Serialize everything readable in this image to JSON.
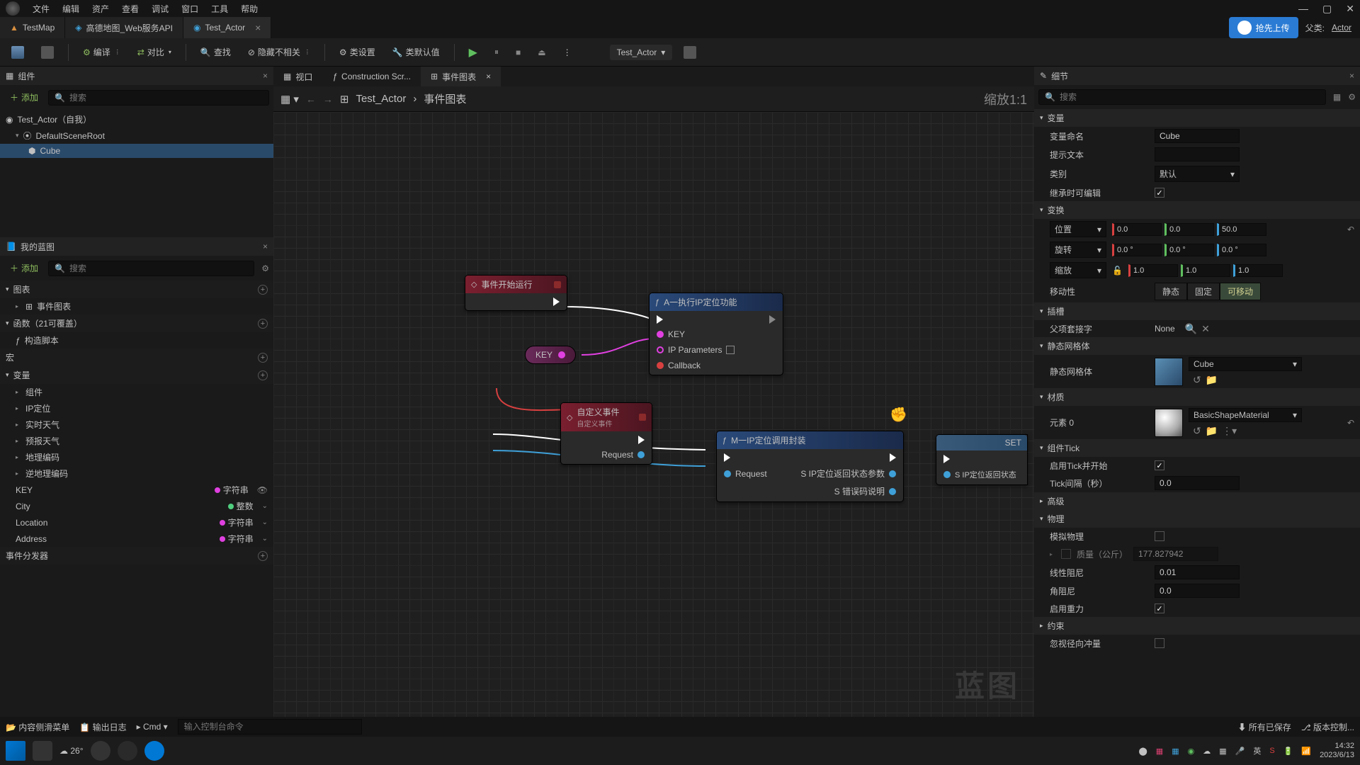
{
  "menubar": {
    "items": [
      "文件",
      "编辑",
      "资产",
      "查看",
      "调试",
      "窗口",
      "工具",
      "帮助"
    ]
  },
  "tabs": {
    "items": [
      {
        "label": "TestMap"
      },
      {
        "label": "高德地图_Web服务API"
      },
      {
        "label": "Test_Actor",
        "active": true
      }
    ],
    "right": {
      "upload": "抢先上传",
      "parent": "父类:",
      "actor": "Actor"
    }
  },
  "toolbar": {
    "compile": "编译",
    "diff": "对比",
    "find": "查找",
    "hide": "隐藏不相关",
    "classSettings": "类设置",
    "classDefaults": "类默认值",
    "selector": "Test_Actor"
  },
  "panels": {
    "components": "组件",
    "myblueprint": "我的蓝图",
    "details": "细节",
    "add": "添加",
    "searchPlaceholder": "搜索"
  },
  "componentTree": {
    "root": "Test_Actor（自我）",
    "child1": "DefaultSceneRoot",
    "child2": "Cube"
  },
  "myblueprint": {
    "sections": {
      "graphs": "图表",
      "eventGraph": "事件图表",
      "functions": "函数（21可覆盖）",
      "constructionScript": "构造脚本",
      "macros": "宏",
      "variables": "变量",
      "components": "组件",
      "ipLoc": "IP定位",
      "rtWeather": "实时天气",
      "fcWeather": "预报天气",
      "geo": "地理编码",
      "revGeo": "逆地理编码",
      "eventDispatchers": "事件分发器"
    },
    "vars": {
      "key": {
        "name": "KEY",
        "type": "字符串"
      },
      "city": {
        "name": "City",
        "type": "整数"
      },
      "location": {
        "name": "Location",
        "type": "字符串"
      },
      "address": {
        "name": "Address",
        "type": "字符串"
      }
    }
  },
  "centerTabs": {
    "viewport": "视口",
    "cs": "Construction Scr...",
    "eg": "事件图表"
  },
  "breadcrumb": {
    "root": "Test_Actor",
    "leaf": "事件图表",
    "zoom": "缩放1:1"
  },
  "graph": {
    "watermark": "蓝图",
    "beginPlay": "事件开始运行",
    "nodeA": {
      "title": "A一执行IP定位功能",
      "key": "KEY",
      "ip": "IP Parameters",
      "callback": "Callback"
    },
    "keyVar": "KEY",
    "customEvent": {
      "title": "自定义事件",
      "subtitle": "自定义事件",
      "request": "Request"
    },
    "nodeM": {
      "title": "M一IP定位调用封装",
      "request": "Request",
      "out1": "S IP定位返回状态参数",
      "out2": "S 错误码说明"
    },
    "setNode": {
      "title": "SET",
      "pin": "S IP定位返回状态"
    }
  },
  "details": {
    "sections": {
      "variable": "变量",
      "transform": "变换",
      "sockets": "插槽",
      "staticMesh": "静态网格体",
      "materials": "材质",
      "componentTick": "组件Tick",
      "advanced": "高级",
      "physics": "物理",
      "constraints": "约束"
    },
    "rows": {
      "varName": {
        "label": "变量命名",
        "value": "Cube"
      },
      "tooltip": {
        "label": "提示文本",
        "value": ""
      },
      "category": {
        "label": "类别",
        "value": "默认"
      },
      "editInherited": "继承时可编辑",
      "location": {
        "label": "位置",
        "x": "0.0",
        "y": "0.0",
        "z": "50.0"
      },
      "rotation": {
        "label": "旋转",
        "x": "0.0 °",
        "y": "0.0 °",
        "z": "0.0 °"
      },
      "scale": {
        "label": "缩放",
        "x": "1.0",
        "y": "1.0",
        "z": "1.0"
      },
      "mobility": {
        "label": "移动性",
        "static": "静态",
        "fixed": "固定",
        "movable": "可移动"
      },
      "parentSocket": {
        "label": "父项套接字",
        "value": "None"
      },
      "staticMesh": {
        "label": "静态网格体",
        "value": "Cube"
      },
      "element0": {
        "label": "元素 0",
        "value": "BasicShapeMaterial"
      },
      "tickStart": "启用Tick并开始",
      "tickInterval": {
        "label": "Tick间隔（秒）",
        "value": "0.0"
      },
      "simPhysics": "模拟物理",
      "mass": {
        "label": "质量（公斤）",
        "value": "177.827942"
      },
      "linearDamping": {
        "label": "线性阻尼",
        "value": "0.01"
      },
      "angularDamping": {
        "label": "角阻尼",
        "value": "0.0"
      },
      "enableGravity": "启用重力",
      "ignoreRadial": "忽视径向冲量"
    }
  },
  "statusbar": {
    "contentDrawer": "内容侧滑菜单",
    "outputLog": "输出日志",
    "cmd": "Cmd",
    "cmdPlaceholder": "输入控制台命令",
    "saved": "所有已保存",
    "sourceControl": "版本控制..."
  },
  "taskbar": {
    "weather": "26°",
    "ime": "英",
    "time": "14:32",
    "date": "2023/6/13"
  }
}
